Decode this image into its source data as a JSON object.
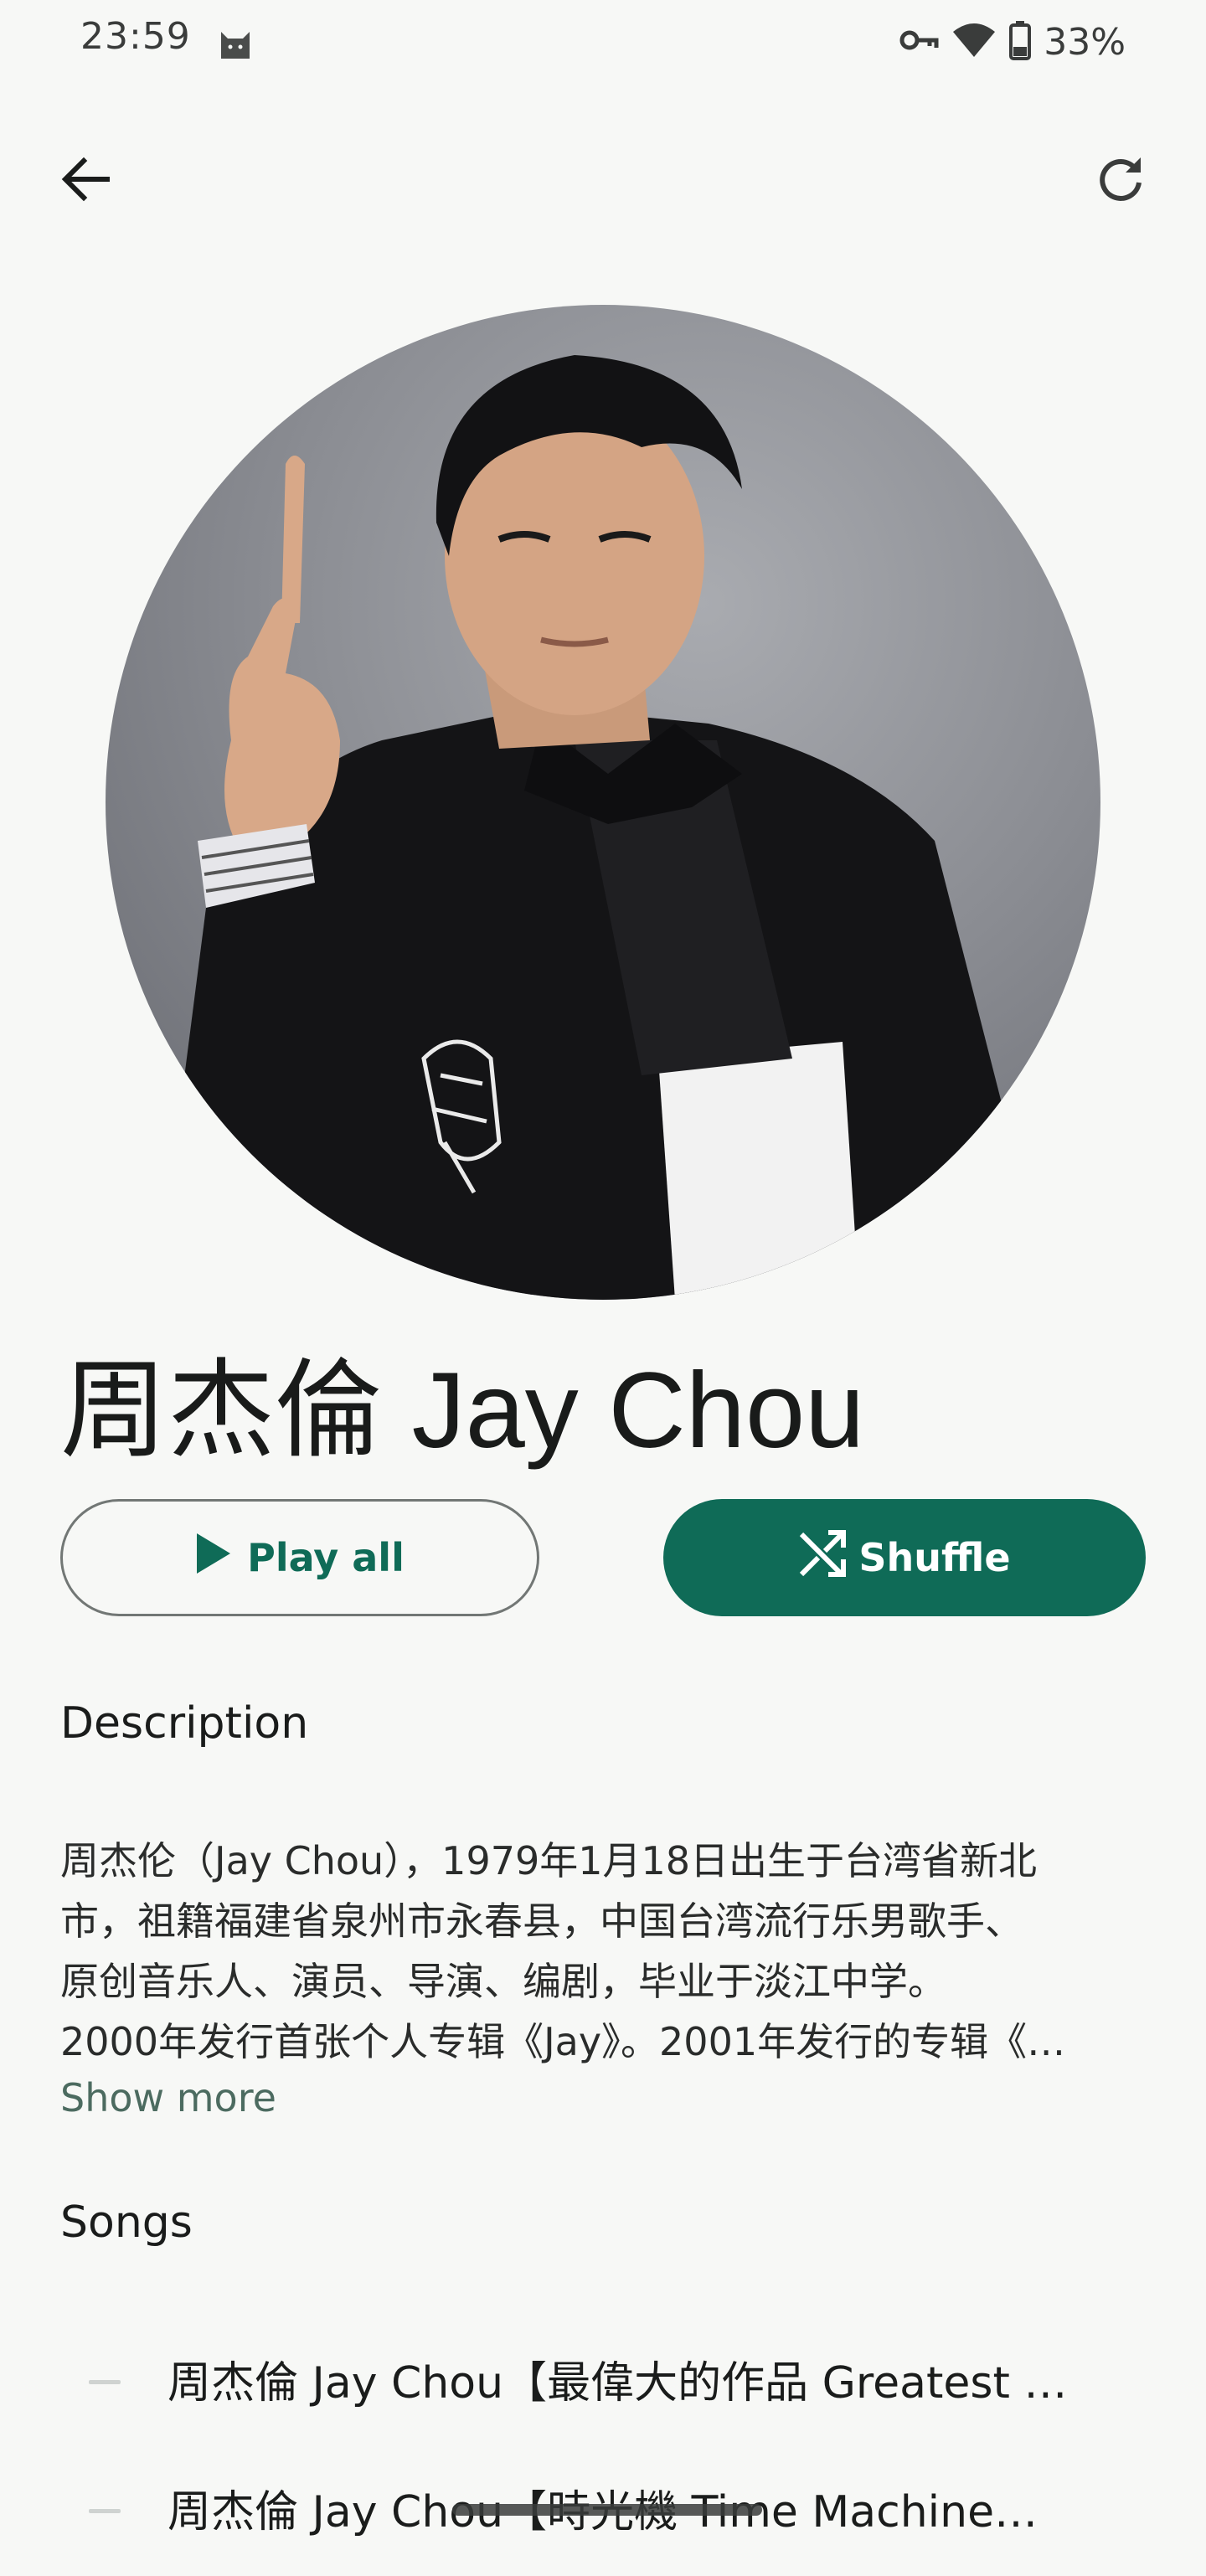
{
  "status_bar": {
    "time": "23:59",
    "battery": "33%",
    "icons": [
      "cat-notification-icon",
      "vpn-key-icon",
      "wifi-icon",
      "battery-icon"
    ]
  },
  "top_bar": {
    "back_icon": "arrow-back-icon",
    "refresh_icon": "refresh-icon"
  },
  "artist": {
    "name": "周杰倫 Jay Chou"
  },
  "actions": {
    "play_all_label": "Play all",
    "shuffle_label": "Shuffle"
  },
  "description": {
    "heading": "Description",
    "lines": [
      "周杰伦（Jay Chou），1979年1月18日出生于台湾省新北",
      "市，祖籍福建省泉州市永春县，中国台湾流行乐男歌手、",
      "原创音乐人、演员、导演、编剧，毕业于淡江中学。",
      "2000年发行首张个人专辑《Jay》。2001年发行的专辑《…"
    ],
    "show_more_label": "Show more"
  },
  "songs": {
    "heading": "Songs",
    "items": [
      {
        "title": "周杰倫 Jay Chou【最偉大的作品 Greatest …"
      },
      {
        "title": "周杰倫 Jay Chou【時光機 Time Machine…"
      }
    ]
  },
  "colors": {
    "accent": "#0f6b57",
    "background": "#f7f8f6",
    "show_more": "#4c6b60"
  }
}
